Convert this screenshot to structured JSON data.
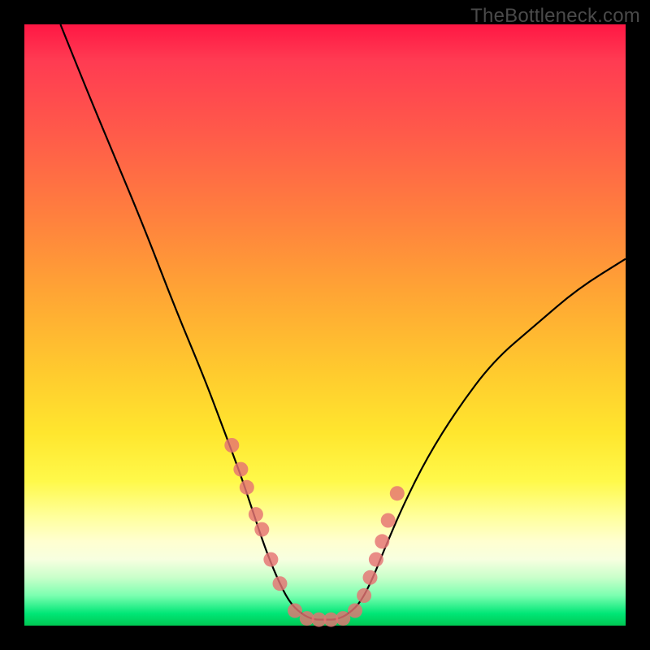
{
  "watermark": "TheBottleneck.com",
  "chart_data": {
    "type": "line",
    "title": "",
    "xlabel": "",
    "ylabel": "",
    "xlim": [
      0,
      100
    ],
    "ylim": [
      0,
      100
    ],
    "grid": false,
    "legend": false,
    "background_gradient": {
      "direction": "vertical",
      "stops": [
        {
          "pos": 0.0,
          "color": "#ff1744"
        },
        {
          "pos": 0.32,
          "color": "#ff803e"
        },
        {
          "pos": 0.58,
          "color": "#ffcb2e"
        },
        {
          "pos": 0.82,
          "color": "#ffff9e"
        },
        {
          "pos": 0.92,
          "color": "#c9ffca"
        },
        {
          "pos": 1.0,
          "color": "#00c853"
        }
      ]
    },
    "series": [
      {
        "name": "bottleneck-curve",
        "x": [
          6,
          10,
          15,
          20,
          25,
          30,
          33,
          36,
          38,
          40,
          42,
          44,
          46,
          48,
          50,
          52,
          54,
          56,
          58,
          60,
          63,
          67,
          72,
          78,
          85,
          92,
          100
        ],
        "values": [
          100,
          90,
          78,
          66,
          53,
          41,
          33,
          25,
          19,
          13,
          8,
          4,
          2,
          1,
          1,
          1,
          2,
          4,
          8,
          13,
          20,
          28,
          36,
          44,
          50,
          56,
          61
        ]
      }
    ],
    "markers": {
      "name": "highlight-points",
      "color": "#e57373",
      "radius": 9,
      "x": [
        34.5,
        36.0,
        37.0,
        38.5,
        39.5,
        41.0,
        42.5,
        45.0,
        47.0,
        49.0,
        51.0,
        53.0,
        55.0,
        56.5,
        57.5,
        58.5,
        59.5,
        60.5,
        62.0
      ],
      "values": [
        30.0,
        26.0,
        23.0,
        18.5,
        16.0,
        11.0,
        7.0,
        2.5,
        1.2,
        1.0,
        1.0,
        1.2,
        2.5,
        5.0,
        8.0,
        11.0,
        14.0,
        17.5,
        22.0
      ]
    }
  }
}
